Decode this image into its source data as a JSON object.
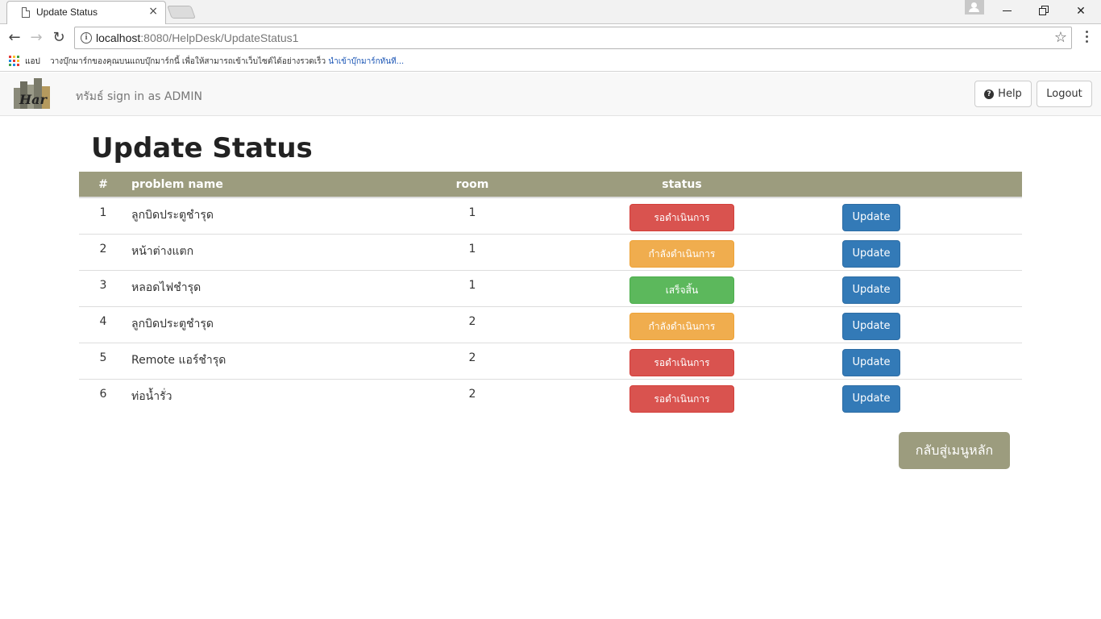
{
  "browser": {
    "tab_title": "Update Status",
    "tab_close": "×",
    "url_host": "localhost",
    "url_rest": ":8080/HelpDesk/UpdateStatus1",
    "apps_label": "แอป",
    "bookmark_prompt": "วางบุ๊กมาร์กของคุณบนแถบบุ๊กมาร์กนี้ เพื่อให้สามารถเข้าเว็บไซต์ได้อย่างรวดเร็ว",
    "bookmark_link": "นำเข้าบุ๊กมาร์กทันที..."
  },
  "navbar": {
    "signed_in_text": "ทรัมธ์ sign in as ADMIN",
    "help_label": "Help",
    "logout_label": "Logout"
  },
  "page": {
    "title": "Update Status",
    "back_label": "กลับสู่เมนูหลัก"
  },
  "table": {
    "headers": {
      "num": "#",
      "name": "problem name",
      "room": "room",
      "status": "status"
    },
    "rows": [
      {
        "num": "1",
        "name": "ลูกบิดประตูชำรุด",
        "room": "1",
        "status": "รอดำเนินการ",
        "update": "Update"
      },
      {
        "num": "2",
        "name": "หน้าต่างแตก",
        "room": "1",
        "status": "กำลังดำเนินการ",
        "update": "Update"
      },
      {
        "num": "3",
        "name": "หลอดไฟชำรุด",
        "room": "1",
        "status": "เสร็จสิ้น",
        "update": "Update"
      },
      {
        "num": "4",
        "name": "ลูกบิดประตูชำรุด",
        "room": "2",
        "status": "กำลังดำเนินการ",
        "update": "Update"
      },
      {
        "num": "5",
        "name": "Remote แอร์ชำรุด",
        "room": "2",
        "status": "รอดำเนินการ",
        "update": "Update"
      },
      {
        "num": "6",
        "name": "ท่อน้ำรั่ว",
        "room": "2",
        "status": "รอดำเนินการ",
        "update": "Update"
      }
    ]
  },
  "colors": {
    "header_bg": "#9c9c7e",
    "status_pending": "#d9534f",
    "status_in_progress": "#f0ad4e",
    "status_done": "#5cb85c",
    "update_button": "#337ab7"
  }
}
